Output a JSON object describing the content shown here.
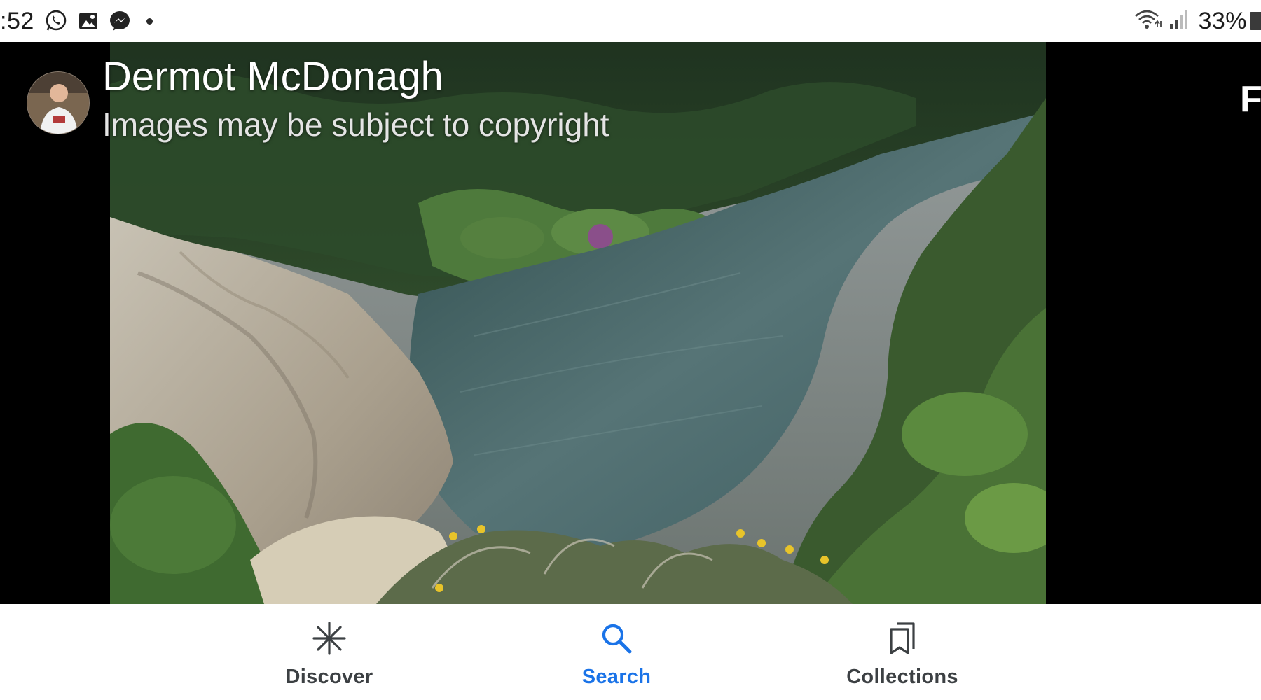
{
  "status_bar": {
    "time": ":52",
    "notification_icons": [
      "whatsapp-icon",
      "gallery-icon",
      "messenger-icon",
      "dot-icon"
    ],
    "battery_text": "33%",
    "system_icons": [
      "wifi-icon",
      "signal-icon",
      "battery-icon"
    ]
  },
  "viewer": {
    "author_name": "Dermot McDonagh",
    "copyright_note": "Images may be subject to copyright",
    "edge_glyph": "F"
  },
  "bottom_nav": {
    "items": [
      {
        "label": "Discover",
        "icon": "asterisk-icon",
        "active": false
      },
      {
        "label": "Search",
        "icon": "search-icon",
        "active": true
      },
      {
        "label": "Collections",
        "icon": "bookmarks-icon",
        "active": false
      }
    ],
    "active_color": "#1a73e8",
    "inactive_color": "#3c4043"
  }
}
